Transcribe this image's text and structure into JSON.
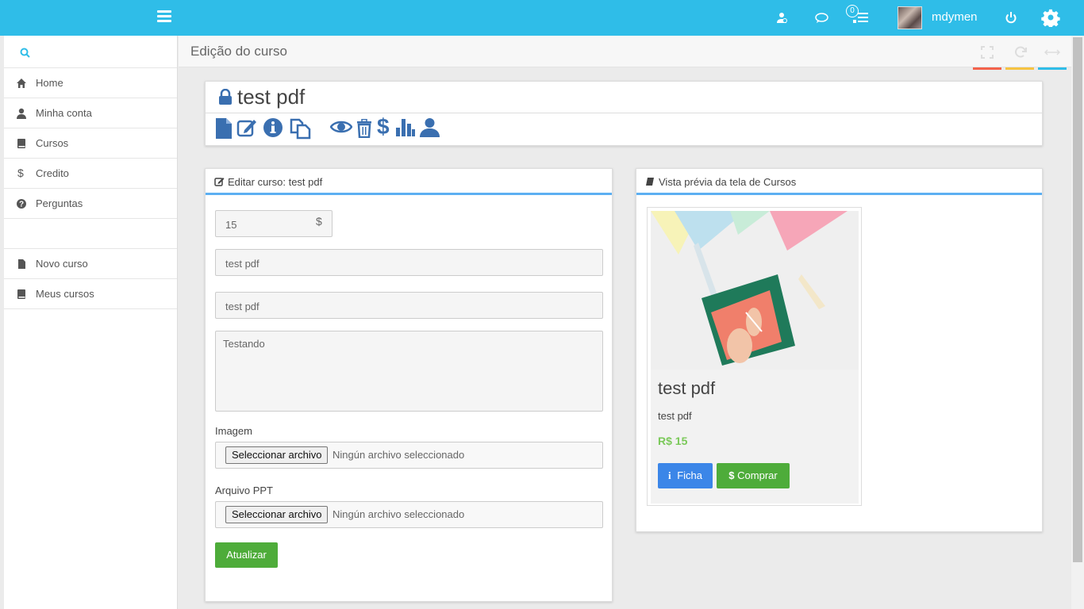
{
  "topbar": {
    "username": "mdymen",
    "notification_count": "0",
    "icons": [
      "menu-icon",
      "users-icon",
      "chat-icon",
      "tasks-icon",
      "power-icon",
      "gear-icon"
    ],
    "color": "#2fbde8"
  },
  "sidebar": {
    "search_icon": "search-icon",
    "items": [
      {
        "label": "Home",
        "icon": "home-icon"
      },
      {
        "label": "Minha conta",
        "icon": "user-icon"
      },
      {
        "label": "Cursos",
        "icon": "book-icon"
      },
      {
        "label": "Credito",
        "icon": "dollar-icon"
      },
      {
        "label": "Perguntas",
        "icon": "question-icon"
      }
    ],
    "items2": [
      {
        "label": "Novo curso",
        "icon": "file-icon"
      },
      {
        "label": "Meus cursos",
        "icon": "book-icon"
      }
    ]
  },
  "page": {
    "title": "Edição do curso",
    "tool_colors": [
      "#f4624b",
      "#f6c342",
      "#2fbde8"
    ]
  },
  "course": {
    "title": "test pdf",
    "actions": [
      "file-icon",
      "edit-icon",
      "info-icon",
      "copy-icon",
      "eye-icon",
      "trash-icon",
      "dollar-icon",
      "chart-icon",
      "user-icon"
    ]
  },
  "edit_panel": {
    "title": "Editar curso: test pdf",
    "price_value": "15",
    "price_symbol": "$",
    "name_value": "test pdf",
    "subtitle_value": "test pdf",
    "description_value": "Testando",
    "image_label": "Imagem",
    "ppt_label": "Arquivo PPT",
    "file_button": "Seleccionar archivo",
    "file_none": "Ningún archivo seleccionado",
    "submit_label": "Atualizar"
  },
  "preview_panel": {
    "title": "Vista prévia da tela de Cursos",
    "card_title": "test pdf",
    "card_subtitle": "test pdf",
    "card_price": "R$ 15",
    "ficha_label": "Ficha",
    "comprar_label": "Comprar"
  }
}
